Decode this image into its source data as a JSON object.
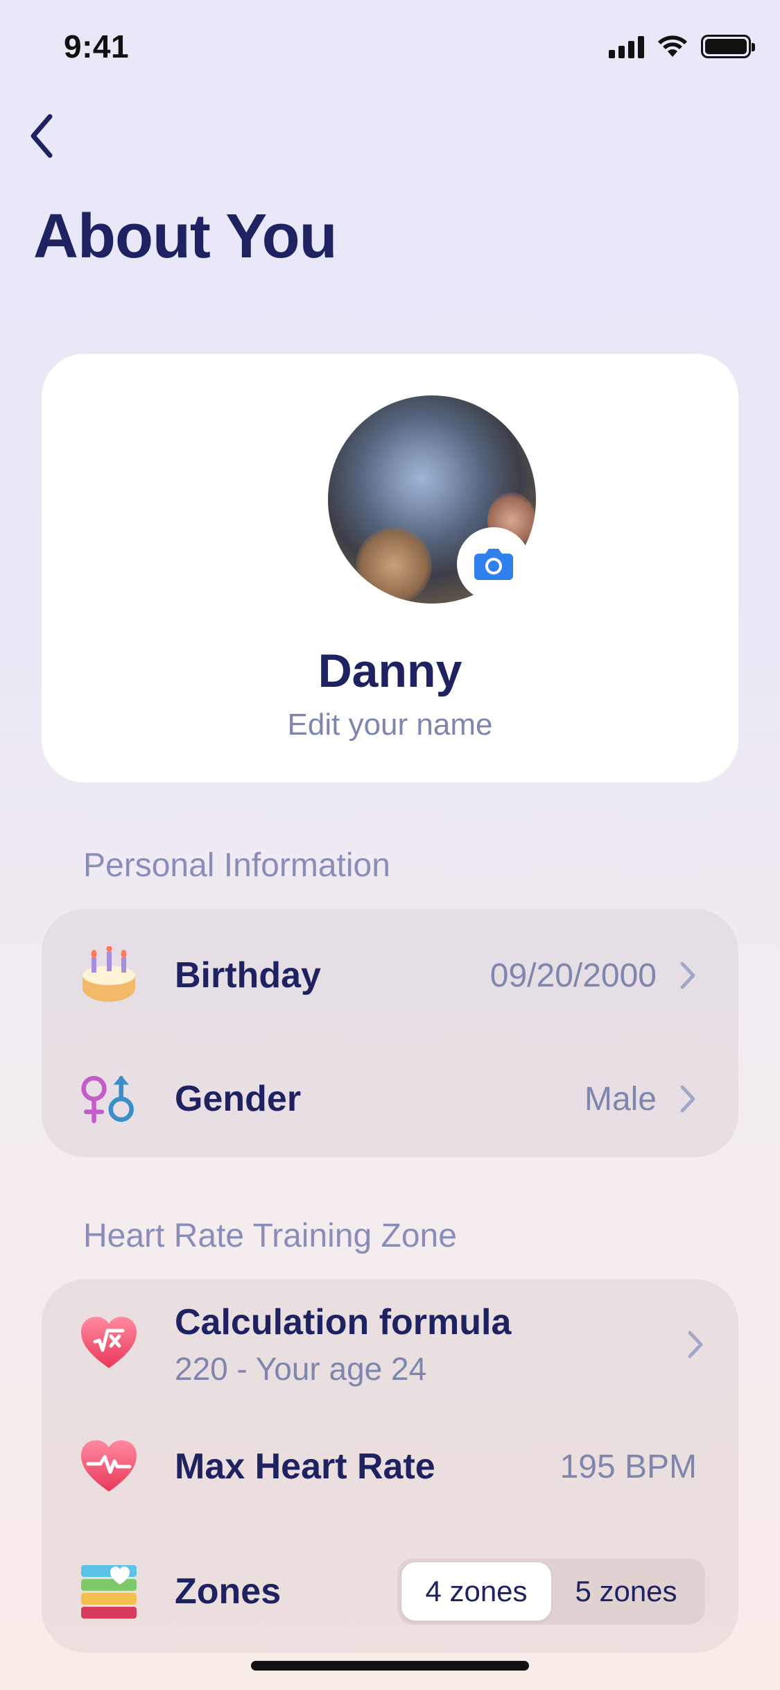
{
  "status_bar": {
    "time": "9:41"
  },
  "header": {
    "title": "About You"
  },
  "profile": {
    "name": "Danny",
    "edit_label": "Edit your name"
  },
  "personal": {
    "section_title": "Personal Information",
    "birthday": {
      "label": "Birthday",
      "value": "09/20/2000",
      "icon": "birthday-cake-icon"
    },
    "gender": {
      "label": "Gender",
      "value": "Male",
      "icon": "gender-icon"
    }
  },
  "heart_rate": {
    "section_title": "Heart Rate Training Zone",
    "formula": {
      "label": "Calculation formula",
      "sublabel": "220 - Your age 24",
      "icon": "heart-formula-icon"
    },
    "max_hr": {
      "label": "Max Heart Rate",
      "value": "195 BPM",
      "icon": "heart-pulse-icon"
    },
    "zones": {
      "label": "Zones",
      "options": [
        "4 zones",
        "5 zones"
      ],
      "selected": "4 zones",
      "icon": "zones-icon"
    }
  },
  "colors": {
    "primary_text": "#1f2260",
    "secondary_text": "#7f86ad",
    "accent_blue": "#2f80ed",
    "heart_red": "#f0506e"
  }
}
